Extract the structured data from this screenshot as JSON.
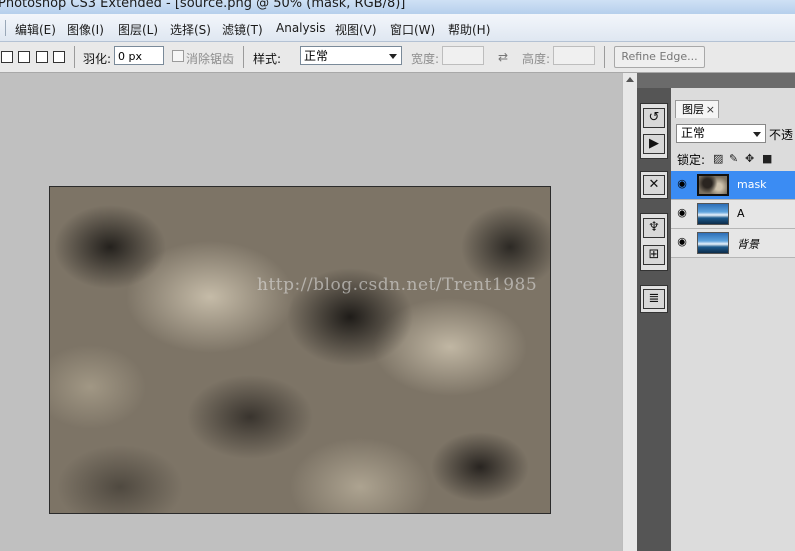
{
  "window": {
    "title": "Photoshop CS3 Extended - [source.png @ 50% (mask, RGB/8)]"
  },
  "menu": {
    "items": [
      "编辑(E)",
      "图像(I)",
      "图层(L)",
      "选择(S)",
      "滤镜(T)",
      "Analysis",
      "视图(V)",
      "窗口(W)",
      "帮助(H)"
    ]
  },
  "options_bar": {
    "feather_label": "羽化:",
    "feather_value": "0 px",
    "antialias_label": "消除锯齿",
    "style_label": "样式:",
    "style_value": "正常",
    "width_label": "宽度:",
    "height_label": "高度:",
    "refine_edge_label": "Refine Edge..."
  },
  "canvas": {
    "watermark": "http://blog.csdn.net/Trent1985"
  },
  "layers_panel": {
    "tab_label": "图层",
    "close_glyph": "×",
    "blend_mode": "正常",
    "opacity_label": "不透",
    "lock_label": "锁定:",
    "layers": [
      {
        "name": "mask",
        "selected": true,
        "thumb": "noise"
      },
      {
        "name": "A",
        "selected": false,
        "thumb": "photo"
      },
      {
        "name": "背景",
        "selected": false,
        "thumb": "photo"
      }
    ]
  },
  "icons": {
    "dock": [
      "history-icon",
      "actions-icon",
      "tools-preset-icon",
      "brushes-icon",
      "clone-source-icon",
      "layer-comps-icon"
    ],
    "lock": [
      "lock-transparency-icon",
      "lock-paint-icon",
      "lock-position-icon",
      "lock-all-icon"
    ]
  },
  "colors": {
    "selected_layer": "#3b8cf3",
    "workspace": "#c0c0c0"
  }
}
